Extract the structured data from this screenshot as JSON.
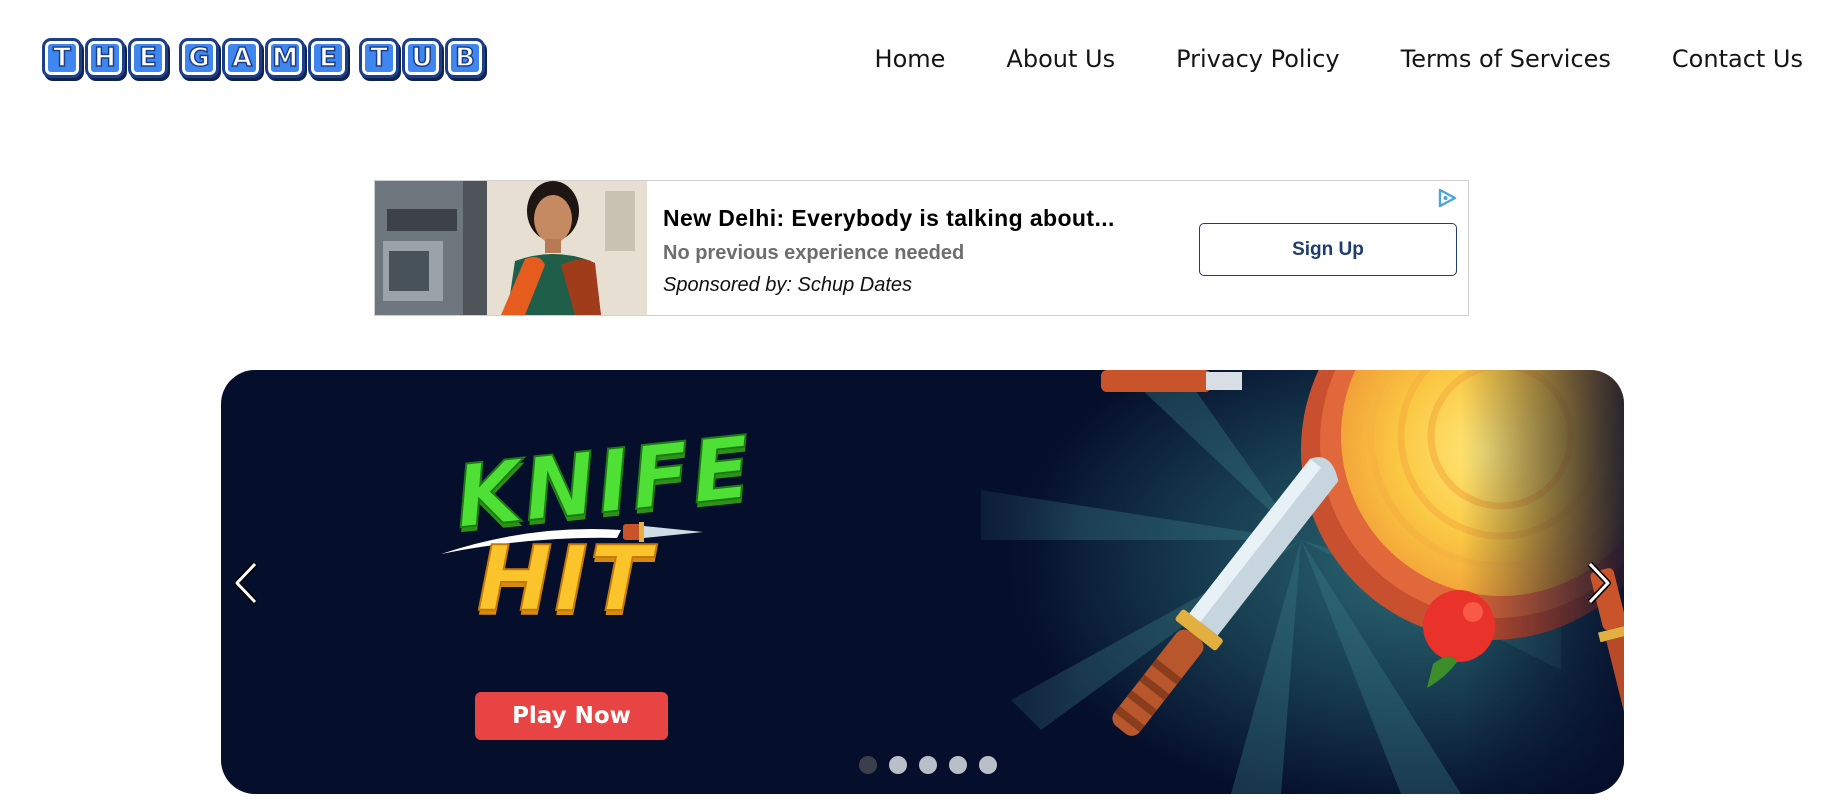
{
  "logo": {
    "words": [
      {
        "letters": [
          "T",
          "H",
          "E"
        ]
      },
      {
        "letters": [
          "G",
          "A",
          "M",
          "E"
        ]
      },
      {
        "letters": [
          "T",
          "U",
          "B"
        ]
      }
    ]
  },
  "nav": {
    "items": [
      {
        "label": "Home"
      },
      {
        "label": "About Us"
      },
      {
        "label": "Privacy Policy"
      },
      {
        "label": "Terms of Services"
      },
      {
        "label": "Contact Us"
      }
    ]
  },
  "ad": {
    "headline": "New Delhi: Everybody is talking about...",
    "subtext": "No previous experience needed",
    "sponsor": "Sponsored by: Schup Dates",
    "cta_label": "Sign Up",
    "choices_icon": "adchoices-icon"
  },
  "hero": {
    "game_title_line1": "KNIFE",
    "game_title_line2": "HIT",
    "play_label": "Play Now",
    "prev_icon": "chevron-left-icon",
    "next_icon": "chevron-right-icon",
    "slide_count": 5,
    "active_slide": 1
  },
  "colors": {
    "logo_tile": "#3f86ef",
    "hero_background": "#050e2b",
    "play_button": "#e84444",
    "ad_cta_border": "#1f3d6e",
    "knife_green": "#4fe036",
    "hit_yellow": "#fbc42a"
  }
}
